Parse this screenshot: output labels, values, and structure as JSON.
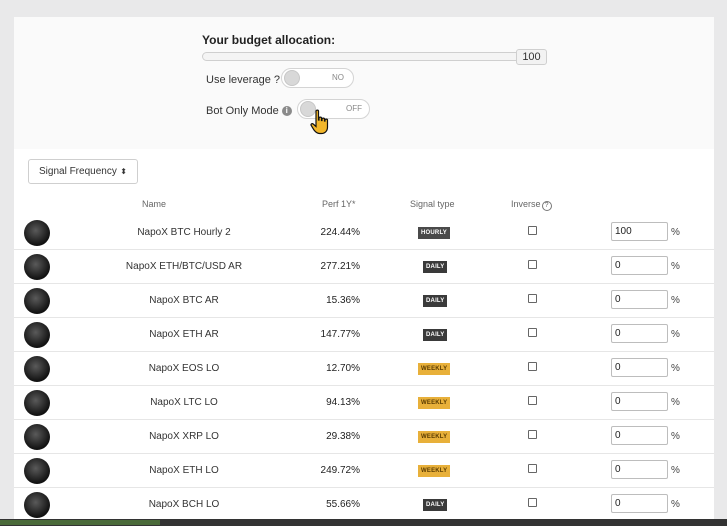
{
  "budget": {
    "title": "Your budget allocation:",
    "value": "100"
  },
  "leverage": {
    "label": "Use leverage ?",
    "state": "NO"
  },
  "bot_only": {
    "label": "Bot Only Mode",
    "state": "OFF"
  },
  "frequency_select": {
    "label": "Signal Frequency",
    "caret": "⬍"
  },
  "table": {
    "headers": {
      "name": "Name",
      "perf": "Perf 1Y*",
      "signal_type": "Signal type",
      "inverse": "Inverse",
      "help": "?"
    },
    "pct_symbol": "%",
    "rows": [
      {
        "name": "NapoX BTC Hourly 2",
        "perf": "224.44%",
        "signal": "HOURLY",
        "signal_kind": "hourly",
        "inverse": false,
        "allocation": "100"
      },
      {
        "name": "NapoX ETH/BTC/USD AR",
        "perf": "277.21%",
        "signal": "DAILY",
        "signal_kind": "daily",
        "inverse": false,
        "allocation": "0"
      },
      {
        "name": "NapoX BTC AR",
        "perf": "15.36%",
        "signal": "DAILY",
        "signal_kind": "daily",
        "inverse": false,
        "allocation": "0"
      },
      {
        "name": "NapoX ETH AR",
        "perf": "147.77%",
        "signal": "DAILY",
        "signal_kind": "daily",
        "inverse": false,
        "allocation": "0"
      },
      {
        "name": "NapoX EOS LO",
        "perf": "12.70%",
        "signal": "WEEKLY",
        "signal_kind": "weekly",
        "inverse": false,
        "allocation": "0"
      },
      {
        "name": "NapoX LTC LO",
        "perf": "94.13%",
        "signal": "WEEKLY",
        "signal_kind": "weekly",
        "inverse": false,
        "allocation": "0"
      },
      {
        "name": "NapoX XRP LO",
        "perf": "29.38%",
        "signal": "WEEKLY",
        "signal_kind": "weekly",
        "inverse": false,
        "allocation": "0"
      },
      {
        "name": "NapoX ETH LO",
        "perf": "249.72%",
        "signal": "WEEKLY",
        "signal_kind": "weekly",
        "inverse": false,
        "allocation": "0"
      },
      {
        "name": "NapoX BCH LO",
        "perf": "55.66%",
        "signal": "DAILY",
        "signal_kind": "daily",
        "inverse": false,
        "allocation": "0"
      }
    ]
  },
  "colors": {
    "weekly_badge": "#e8b03a",
    "daily_badge": "#3a3a3a",
    "hourly_badge": "#4a4a4a",
    "page_background": "#e9e9ea"
  },
  "icons": {
    "info": "info-icon",
    "pointer": "hand-pointer-icon",
    "avatar": "strategy-avatar-icon"
  }
}
